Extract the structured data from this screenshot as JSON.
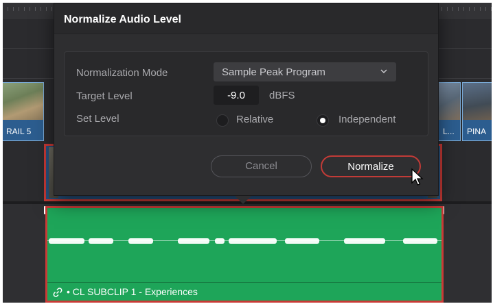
{
  "dialog": {
    "title": "Normalize Audio Level",
    "normalization_mode_label": "Normalization Mode",
    "normalization_mode_value": "Sample Peak Program",
    "target_level_label": "Target Level",
    "target_level_value": "-9.0",
    "target_level_unit": "dBFS",
    "set_level_label": "Set Level",
    "options": [
      {
        "label": "Relative",
        "selected": false
      },
      {
        "label": "Independent",
        "selected": true
      }
    ],
    "cancel_label": "Cancel",
    "normalize_label": "Normalize"
  },
  "timeline": {
    "clips_left": [
      {
        "label": "RAIL 5"
      }
    ],
    "clips_right": [
      {
        "label": "L..."
      },
      {
        "label": "PINA"
      }
    ],
    "audio_clip_name": "CL SUBCLIP 1 - Experiences"
  },
  "colors": {
    "accent_red": "#c93a36",
    "audio_green": "#1ea559",
    "video_blue": "#2c5d8f"
  },
  "icons": [
    "chevron-down-icon",
    "link-icon",
    "mouse-cursor-icon"
  ]
}
